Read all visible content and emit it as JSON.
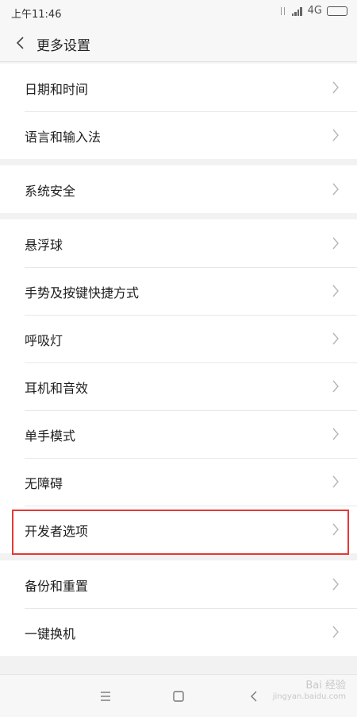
{
  "status": {
    "time": "上午11:46",
    "network": "4G",
    "battery_level": 1.0
  },
  "header": {
    "title": "更多设置"
  },
  "groups": [
    {
      "items": [
        {
          "label": "日期和时间"
        },
        {
          "label": "语言和输入法"
        }
      ]
    },
    {
      "items": [
        {
          "label": "系统安全"
        }
      ]
    },
    {
      "items": [
        {
          "label": "悬浮球"
        },
        {
          "label": "手势及按键快捷方式"
        },
        {
          "label": "呼吸灯"
        },
        {
          "label": "耳机和音效"
        },
        {
          "label": "单手模式"
        },
        {
          "label": "无障碍"
        },
        {
          "label": "开发者选项"
        }
      ]
    },
    {
      "items": [
        {
          "label": "备份和重置"
        },
        {
          "label": "一键换机"
        }
      ]
    }
  ],
  "highlight_color": "#e53935",
  "watermark": {
    "text": "Bai 经验",
    "sub": "jingyan.baidu.com"
  }
}
